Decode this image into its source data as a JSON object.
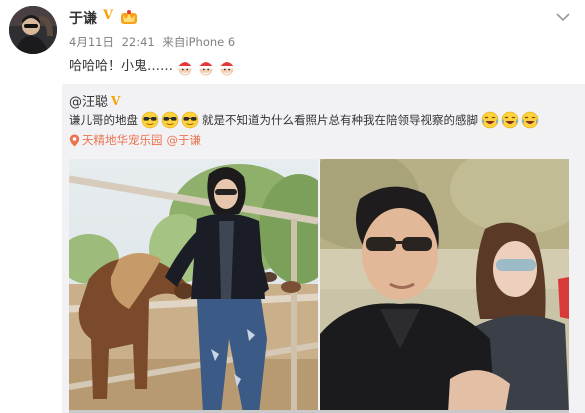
{
  "post": {
    "author": "于谦",
    "verified_mark": "V",
    "date": "4月11日",
    "time": "22:41",
    "source_prefix": "来自",
    "source": "iPhone 6",
    "text": "哈哈哈！小鬼……",
    "santa_emoji_count": 3,
    "more_icon": "chevron-down-icon"
  },
  "repost": {
    "user": "@汪聪",
    "verified_mark": "V",
    "text_before": "谦儿哥的地盘",
    "text_after": "就是不知道为什么看照片总有种我在陪领导视察的感脚",
    "location": "天精地华宠乐园",
    "mention": "@于谦",
    "photo_count": 2
  },
  "colors": {
    "link": "#eb7350",
    "verified": "#f6a200",
    "repost_bg": "#f2f2f5",
    "meta_text": "#808080"
  }
}
